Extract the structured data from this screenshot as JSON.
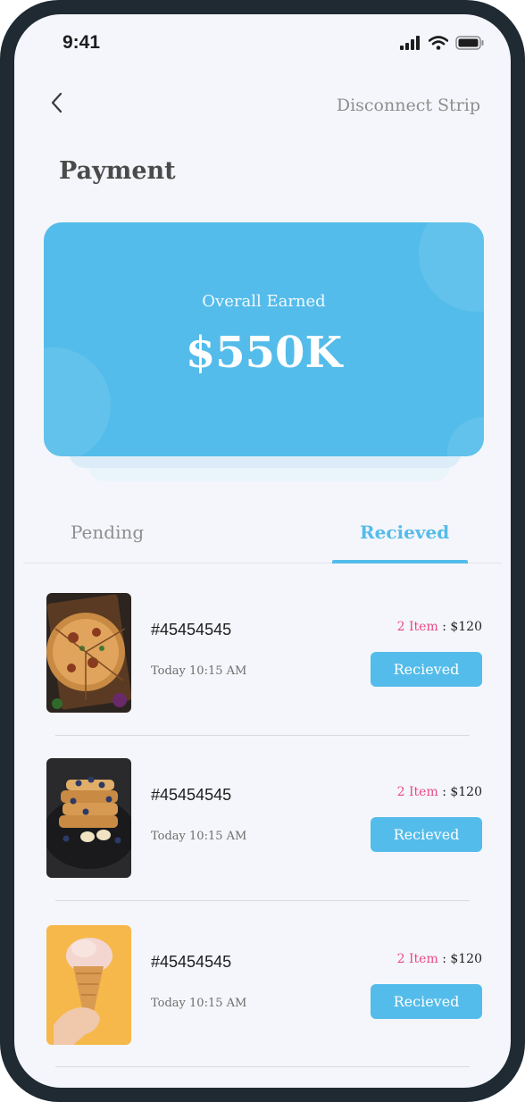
{
  "status_bar": {
    "time": "9:41",
    "icons": [
      "signal-icon",
      "wifi-icon",
      "battery-icon"
    ]
  },
  "header": {
    "back_icon": "chevron-left-icon",
    "disconnect_label": "Disconnect Strip",
    "title": "Payment"
  },
  "summary_card": {
    "label": "Overall Earned",
    "value": "$550K",
    "color": "#54bcea"
  },
  "tabs": [
    {
      "label": "Pending",
      "active": false
    },
    {
      "label": "Recieved",
      "active": true
    }
  ],
  "orders": [
    {
      "id": "#45454545",
      "time": "Today 10:15 AM",
      "items": "2 Item",
      "separator": ":",
      "amount": "$120",
      "button": "Recieved",
      "image": "pizza-photo"
    },
    {
      "id": "#45454545",
      "time": "Today 10:15 AM",
      "items": "2 Item",
      "separator": ":",
      "amount": "$120",
      "button": "Recieved",
      "image": "french-toast-photo"
    },
    {
      "id": "#45454545",
      "time": "Today 10:15 AM",
      "items": "2 Item",
      "separator": ":",
      "amount": "$120",
      "button": "Recieved",
      "image": "ice-cream-photo"
    }
  ],
  "colors": {
    "accent": "#54bcea",
    "item_count": "#ea4a83",
    "background": "#f5f6fb",
    "frame": "#1f2a33"
  }
}
